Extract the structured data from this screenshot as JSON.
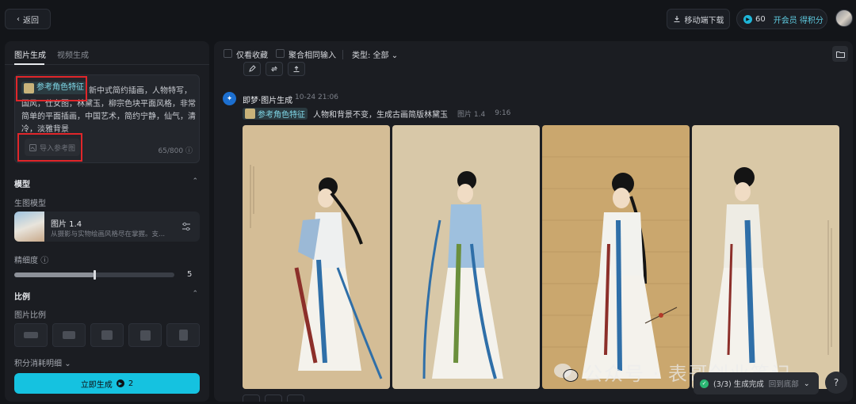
{
  "topbar": {
    "back_label": "返回",
    "mobile_label": "移动端下载",
    "credits": "60",
    "vip_label": "开会员 得积分"
  },
  "left_panel": {
    "tabs": [
      {
        "label": "图片生成",
        "active": true
      },
      {
        "label": "视频生成",
        "active": false
      }
    ],
    "prompt": {
      "ref_tag": "参考角色特征",
      "text": "新中式简约插画，人物特写，国风，仕女图，林黛玉，柳宗色块平面风格，非常简单的平面插画，中国艺术，简约宁静，仙气，清冷，淡雅背景",
      "import_label": "导入参考图",
      "counter": "65/800"
    },
    "model_section": {
      "title": "模型",
      "sub_label": "生图模型",
      "model_name": "图片 1.4",
      "model_desc": "从摄影与实物绘画风格尽在掌握。支..."
    },
    "fineness": {
      "label": "精细度",
      "value": "5",
      "level_fraction": 0.5
    },
    "ratio_section": {
      "title": "比例",
      "sub_label": "图片比例"
    },
    "consume_label": "积分消耗明细",
    "generate_label": "立即生成",
    "generate_cost": "2"
  },
  "right_panel": {
    "filters": {
      "favorites_label": "仅看收藏",
      "merge_label": "聚合相同输入",
      "type_label": "类型: 全部"
    },
    "message": {
      "title": "即梦·图片生成",
      "time": "10-24 21:06",
      "ref_tag": "参考角色特征",
      "prompt": "人物和背景不变，生成古画简版林黛玉",
      "model": "图片 1.4",
      "ratio": "9:16"
    }
  },
  "toast": {
    "status": "(3/3) 生成完成",
    "link": "回到底部"
  },
  "help_label": "?",
  "watermark": "公众号 · 表哥创业笔记",
  "colors": {
    "accent": "#15c2e0",
    "highlight_box": "#e0262a",
    "background": "#131519",
    "panel": "#1b1d22"
  }
}
